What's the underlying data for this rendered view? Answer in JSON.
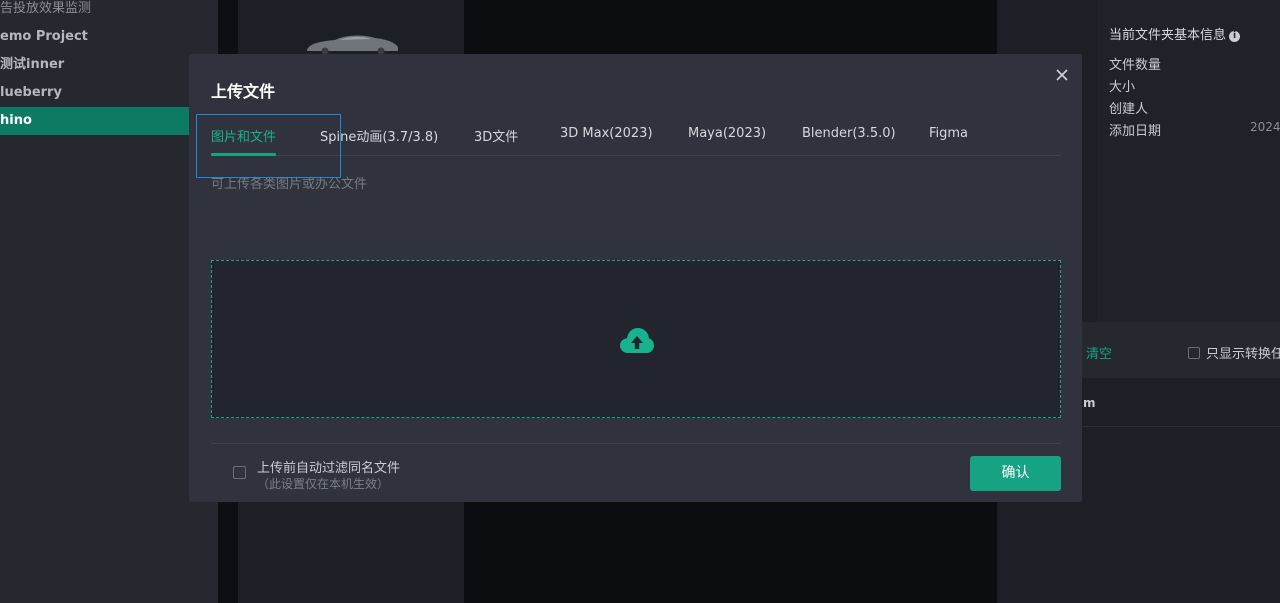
{
  "sidebar": {
    "items": [
      {
        "label": "告投放效果监测"
      },
      {
        "label": "emo Project"
      },
      {
        "label": "测试inner"
      },
      {
        "label": "lueberry"
      },
      {
        "label": "hino"
      }
    ]
  },
  "info_panel": {
    "title": "当前文件夹基本信息",
    "info_icon": "info-icon",
    "rows": [
      "文件数量",
      "大小",
      "创建人",
      "添加日期"
    ],
    "date_value": "2024"
  },
  "list_toolbar": {
    "clear_label": "清空",
    "only_show_label": "只显示转换任",
    "header_text": "m"
  },
  "modal": {
    "title": "上传文件",
    "close_icon": "close-icon",
    "tabs": [
      {
        "label": "图片和文件",
        "active": true
      },
      {
        "label": "Spine动画(3.7/3.8)"
      },
      {
        "label": "3D文件"
      },
      {
        "label": "3D Max(2023)"
      },
      {
        "label": "Maya(2023)"
      },
      {
        "label": "Blender(3.5.0)"
      },
      {
        "label": "Figma"
      }
    ],
    "hint": "可上传各类图片或办公文件",
    "dropzone_icon": "cloud-upload-icon",
    "filter_label": "上传前自动过滤同名文件",
    "filter_sub": "（此设置仅在本机生效）",
    "filter_checked": false,
    "confirm_label": "确认"
  },
  "colors": {
    "accent": "#16a383",
    "focus": "#1e88d9",
    "modal_bg": "#30333d"
  }
}
